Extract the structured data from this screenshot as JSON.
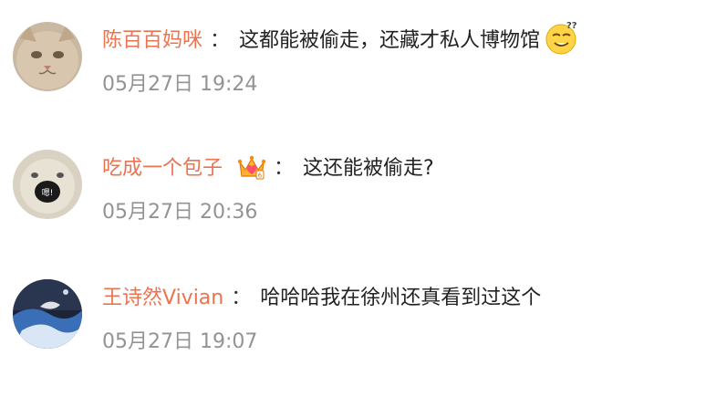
{
  "comments": [
    {
      "username": "陈百百妈咪",
      "separator": "：",
      "text": "这都能被偷走，还藏才私人博物馆",
      "emoji": "dizzy-face-emoji",
      "time": "05月27日 19:24",
      "avatar": "cat-face-avatar"
    },
    {
      "username": "吃成一个包子",
      "separator": "：",
      "text": "这还能被偷走?",
      "badge": "crown-heart-badge",
      "time": "05月27日 20:36",
      "avatar": "screaming-face-avatar"
    },
    {
      "username": "王诗然Vivian",
      "separator": "：",
      "text": "哈哈哈我在徐州还真看到过这个",
      "time": "05月27日 19:07",
      "avatar": "night-landscape-avatar"
    }
  ],
  "colors": {
    "username": "#eb7350",
    "timestamp": "#939393",
    "text": "#222222"
  }
}
